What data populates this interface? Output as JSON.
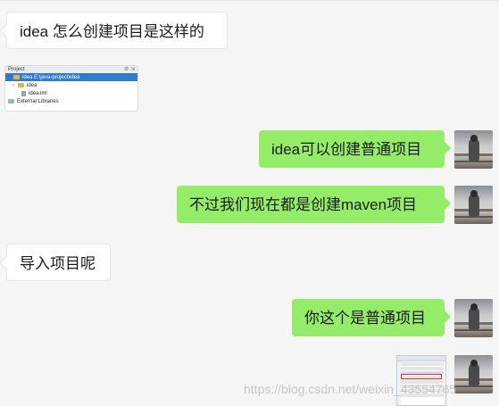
{
  "messages": [
    {
      "side": "in",
      "text": "idea 怎么创建项目是这样的"
    },
    {
      "side": "in",
      "type": "image",
      "image": {
        "title": "Project",
        "rows": [
          "idea  E:\\java-project\\idea",
          "idea",
          "idea.iml",
          "External Libraries"
        ]
      }
    },
    {
      "side": "out",
      "text": "idea可以创建普通项目"
    },
    {
      "side": "out",
      "text": "不过我们现在都是创建maven项目"
    },
    {
      "side": "in",
      "text": "导入项目呢"
    },
    {
      "side": "out",
      "text": "你这个是普通项目"
    },
    {
      "side": "out",
      "type": "image"
    }
  ],
  "watermark": "https://blog.csdn.net/weixin_43554765",
  "colors": {
    "background": "#f5f5f5",
    "incoming_bubble": "#ffffff",
    "outgoing_bubble": "#95ec69",
    "tree_selection": "#2f7dc9"
  },
  "icons": [
    "avatar",
    "folder-icon",
    "file-icon",
    "library-icon",
    "chevron-right-icon"
  ]
}
